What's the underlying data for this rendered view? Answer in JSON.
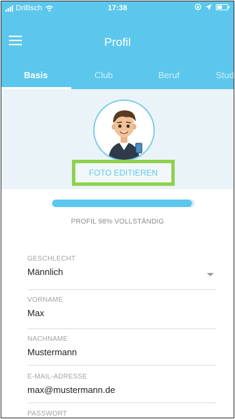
{
  "statusbar": {
    "carrier": "Drillisch",
    "time": "17:38"
  },
  "nav": {
    "title": "Profil"
  },
  "tabs": [
    {
      "label": "Basis"
    },
    {
      "label": "Club"
    },
    {
      "label": "Beruf"
    },
    {
      "label": "Stud"
    }
  ],
  "profile": {
    "edit_photo_label": "FOTO EDITIEREN",
    "completion_label": "PROFIL 98% VOLLSTÄNDIG",
    "completion_fraction": 0.98
  },
  "form": {
    "gender": {
      "label": "GESCHLECHT",
      "value": "Männlich"
    },
    "firstname": {
      "label": "VORNAME",
      "value": "Max"
    },
    "lastname": {
      "label": "NACHNAME",
      "value": "Mustermann"
    },
    "email": {
      "label": "E-MAIL-ADRESSE",
      "value": "max@mustermann.de"
    },
    "password": {
      "label": "PASSWORT"
    }
  },
  "colors": {
    "accent": "#5cc7ec",
    "highlight": "#8fd14f"
  }
}
